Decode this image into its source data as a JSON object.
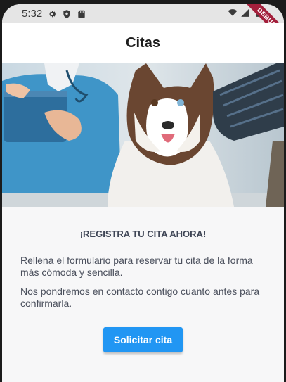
{
  "status_bar": {
    "time": "5:32",
    "icons": [
      "settings-icon",
      "shield-icon",
      "sd-card-icon",
      "wifi-icon",
      "signal-icon",
      "battery-icon"
    ]
  },
  "debug_banner": "DEBUG",
  "app_bar": {
    "title": "Citas"
  },
  "hero": {
    "image": "veterinarian-with-husky-dog-photo"
  },
  "content": {
    "headline": "¡REGISTRA TU CITA AHORA!",
    "paragraph_1": "Rellena el formulario para reservar tu cita de la forma más cómoda y sencilla.",
    "paragraph_2": "Nos pondremos en contacto contigo cuanto antes para confirmarla.",
    "button_label": "Solicitar cita"
  },
  "colors": {
    "accent": "#2196f3",
    "background": "#f7f7f8",
    "text": "#4a4f5c"
  }
}
